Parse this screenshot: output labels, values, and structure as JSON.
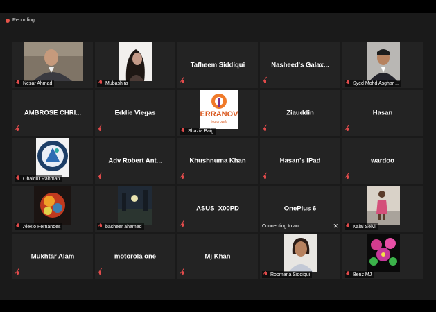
{
  "recording": {
    "label": "Recording"
  },
  "tiles": [
    {
      "name": "Nesar Ahmad",
      "mode": "photo"
    },
    {
      "name": "Mubashira",
      "mode": "photo"
    },
    {
      "name": "Tafheem Siddiqui",
      "mode": "text"
    },
    {
      "name": "Nasheed's  Galax...",
      "mode": "text"
    },
    {
      "name": "Syed Mohd Asghar ...",
      "mode": "photo"
    },
    {
      "name": "AMBROSE  CHRI...",
      "mode": "text"
    },
    {
      "name": "Eddie Viegas",
      "mode": "text"
    },
    {
      "name": "Shazia Baig",
      "mode": "photo",
      "logo_text": "ERRANOV",
      "logo_sub": "ing growth"
    },
    {
      "name": "Ziauddin",
      "mode": "text"
    },
    {
      "name": "Hasan",
      "mode": "text"
    },
    {
      "name": "Obaidur Rahman",
      "mode": "photo"
    },
    {
      "name": "Adv Robert Ant...",
      "mode": "text"
    },
    {
      "name": "Khushnuma Khan",
      "mode": "text"
    },
    {
      "name": "Hasan's iPad",
      "mode": "text"
    },
    {
      "name": "wardoo",
      "mode": "text"
    },
    {
      "name": "Alexio Fernandes",
      "mode": "photo"
    },
    {
      "name": "basheer ahamed",
      "mode": "photo"
    },
    {
      "name": "ASUS_X00PD",
      "mode": "text"
    },
    {
      "name": "OnePlus 6",
      "mode": "text",
      "status": "Connecting to au..."
    },
    {
      "name": "Kalai Selvi",
      "mode": "photo"
    },
    {
      "name": "Mukhtar Alam",
      "mode": "text"
    },
    {
      "name": "motorola one",
      "mode": "text"
    },
    {
      "name": "Mj Khan",
      "mode": "text"
    },
    {
      "name": "Roomana Siddiqui",
      "mode": "photo"
    },
    {
      "name": "Benz MJ",
      "mode": "photo"
    }
  ]
}
